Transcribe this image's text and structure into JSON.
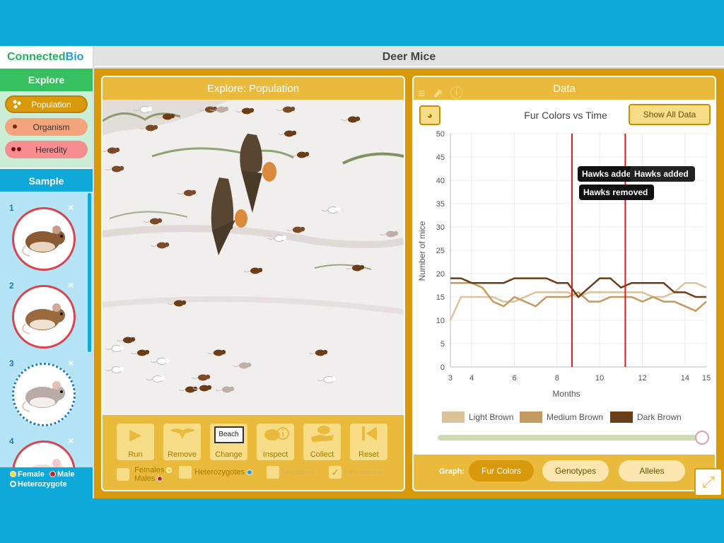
{
  "app": {
    "logo_part1": "Connected",
    "logo_part2": "Bio",
    "title": "Deer Mice"
  },
  "sidebar": {
    "explore_title": "Explore",
    "nav": [
      {
        "label": "Population",
        "icon": "population-dots-icon",
        "active": true
      },
      {
        "label": "Organism",
        "icon": "organism-dot-icon",
        "active": false
      },
      {
        "label": "Heredity",
        "icon": "heredity-dots-icon",
        "active": false
      }
    ],
    "sample_title": "Sample",
    "samples": [
      {
        "num": "1",
        "selected": false
      },
      {
        "num": "2",
        "selected": false
      },
      {
        "num": "3",
        "selected": true
      },
      {
        "num": "4",
        "selected": false
      }
    ],
    "close_glyph": "×",
    "legend": {
      "female": "Female",
      "male": "Male",
      "heterozygote": "Heterozygote",
      "female_color": "#f2df3a",
      "male_color": "#c8202f"
    }
  },
  "population": {
    "title": "Explore: Population",
    "tools": [
      {
        "label": "Run",
        "icon": "play-icon"
      },
      {
        "label": "Remove",
        "icon": "hawk-icon"
      },
      {
        "label": "Change",
        "icon": "environment-chip",
        "chip": "Beach"
      },
      {
        "label": "Inspect",
        "icon": "inspect-icon"
      },
      {
        "label": "Collect",
        "icon": "collect-hand-icon"
      },
      {
        "label": "Reset",
        "icon": "reset-icon"
      }
    ],
    "checks": {
      "females_males_1": "Females",
      "females_males_2": "Males",
      "heterozygotes": "Heterozygotes",
      "mutations": "Mutations",
      "inheritance": "Inheritance"
    }
  },
  "data_panel": {
    "title": "Data",
    "header_icons": [
      "sort-icon",
      "trend-chart-icon",
      "info-icon"
    ],
    "show_all": "Show All Data",
    "graph_label": "Graph:",
    "graph_buttons": [
      "Fur Colors",
      "Genotypes",
      "Alleles"
    ],
    "annotations": {
      "hawks_added_1": "Hawks adde",
      "hawks_added_2": "Hawks added",
      "hawks_removed": "Hawks removed"
    }
  },
  "chart_data": {
    "type": "line",
    "title": "Fur Colors vs Time",
    "xlabel": "Months",
    "ylabel": "Number of mice",
    "xlim": [
      3,
      15
    ],
    "ylim": [
      0,
      50
    ],
    "xticks": [
      3,
      4,
      6,
      8,
      10,
      12,
      14,
      15
    ],
    "yticks": [
      0,
      5,
      10,
      15,
      20,
      25,
      30,
      35,
      40,
      45,
      50
    ],
    "grid": true,
    "legend_position": "bottom",
    "x": [
      3,
      3.5,
      4,
      4.5,
      5,
      5.5,
      6,
      6.5,
      7,
      7.5,
      8,
      8.5,
      9,
      9.5,
      10,
      10.5,
      11,
      11.5,
      12,
      12.5,
      13,
      13.5,
      14,
      14.5,
      15
    ],
    "series": [
      {
        "name": "Light Brown",
        "color": "#dcc29a",
        "values": [
          10,
          15,
          15,
          15,
          15,
          14,
          14,
          15,
          16,
          16,
          16,
          16,
          15,
          16,
          16,
          16,
          16,
          16,
          16,
          15,
          15,
          16,
          18,
          18,
          17
        ]
      },
      {
        "name": "Medium Brown",
        "color": "#c49a5e",
        "values": [
          18,
          18,
          18,
          17,
          14,
          13,
          15,
          14,
          13,
          15,
          15,
          15,
          16,
          14,
          14,
          15,
          15,
          15,
          14,
          15,
          14,
          14,
          13,
          12,
          14
        ]
      },
      {
        "name": "Dark Brown",
        "color": "#6a3d17",
        "values": [
          19,
          19,
          18,
          18,
          18,
          18,
          19,
          19,
          19,
          19,
          18,
          18,
          15,
          17,
          19,
          19,
          17,
          18,
          18,
          18,
          18,
          16,
          16,
          15,
          15
        ]
      }
    ],
    "event_lines": [
      {
        "x": 8.7,
        "color": "#e01b1b"
      },
      {
        "x": 11.2,
        "color": "#e01b1b"
      }
    ],
    "time_slider_position": 1.0
  }
}
